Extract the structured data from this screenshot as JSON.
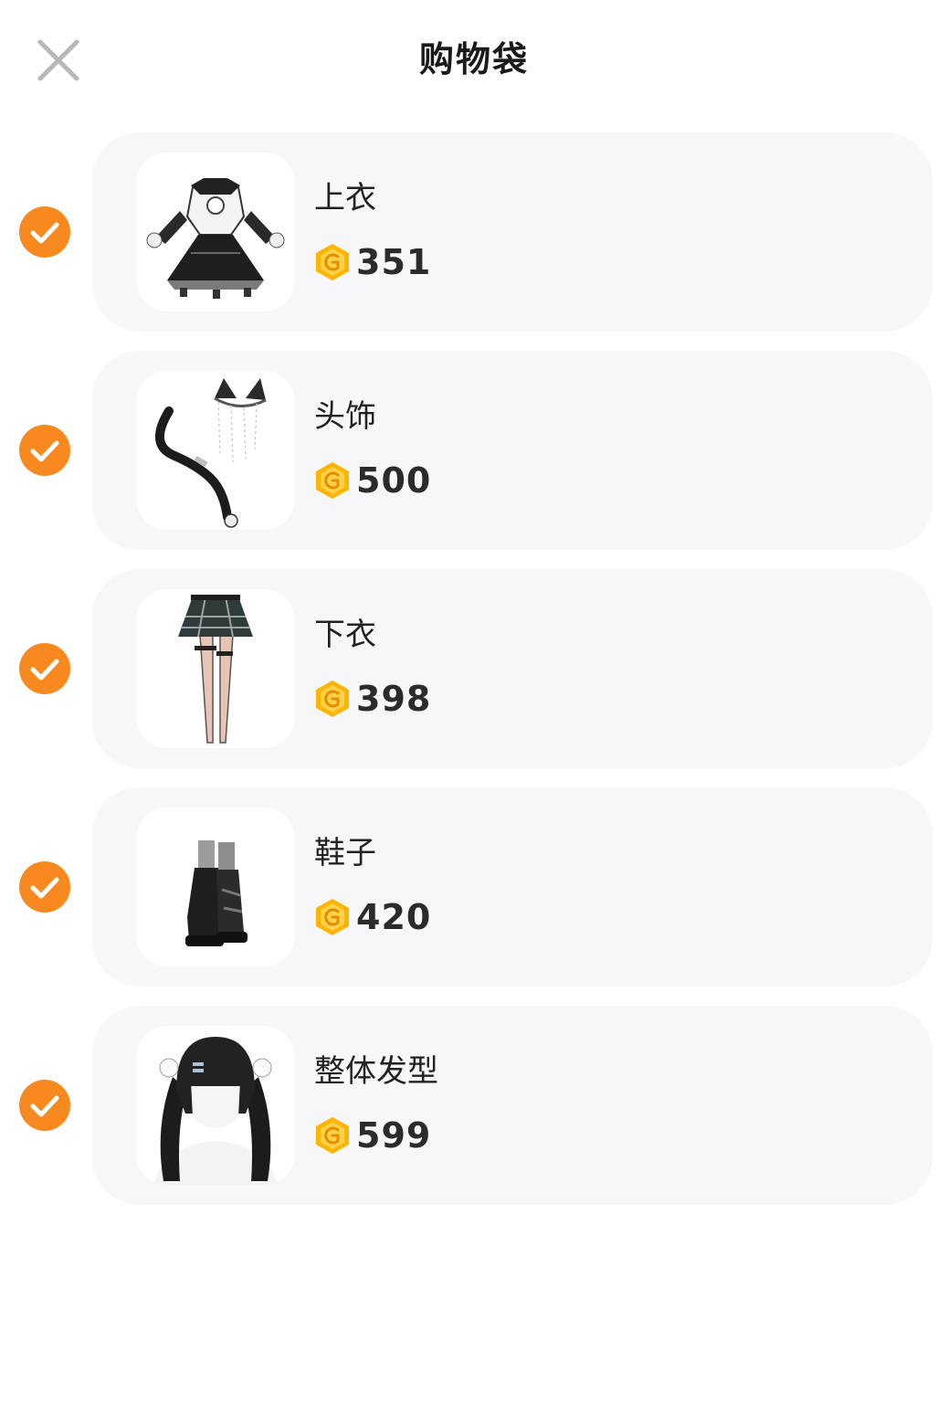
{
  "header": {
    "title": "购物袋",
    "close_icon": "close-icon"
  },
  "colors": {
    "accent": "#f7891f",
    "coin": "#ffb400",
    "card_bg": "#f7f7f9"
  },
  "items": [
    {
      "name": "上衣",
      "price": "351",
      "selected": true,
      "thumb_icon": "dress-thumbnail"
    },
    {
      "name": "头饰",
      "price": "500",
      "selected": true,
      "thumb_icon": "headwear-thumbnail"
    },
    {
      "name": "下衣",
      "price": "398",
      "selected": true,
      "thumb_icon": "skirt-thumbnail"
    },
    {
      "name": "鞋子",
      "price": "420",
      "selected": true,
      "thumb_icon": "boots-thumbnail"
    },
    {
      "name": "整体发型",
      "price": "599",
      "selected": true,
      "thumb_icon": "hairstyle-thumbnail"
    }
  ]
}
